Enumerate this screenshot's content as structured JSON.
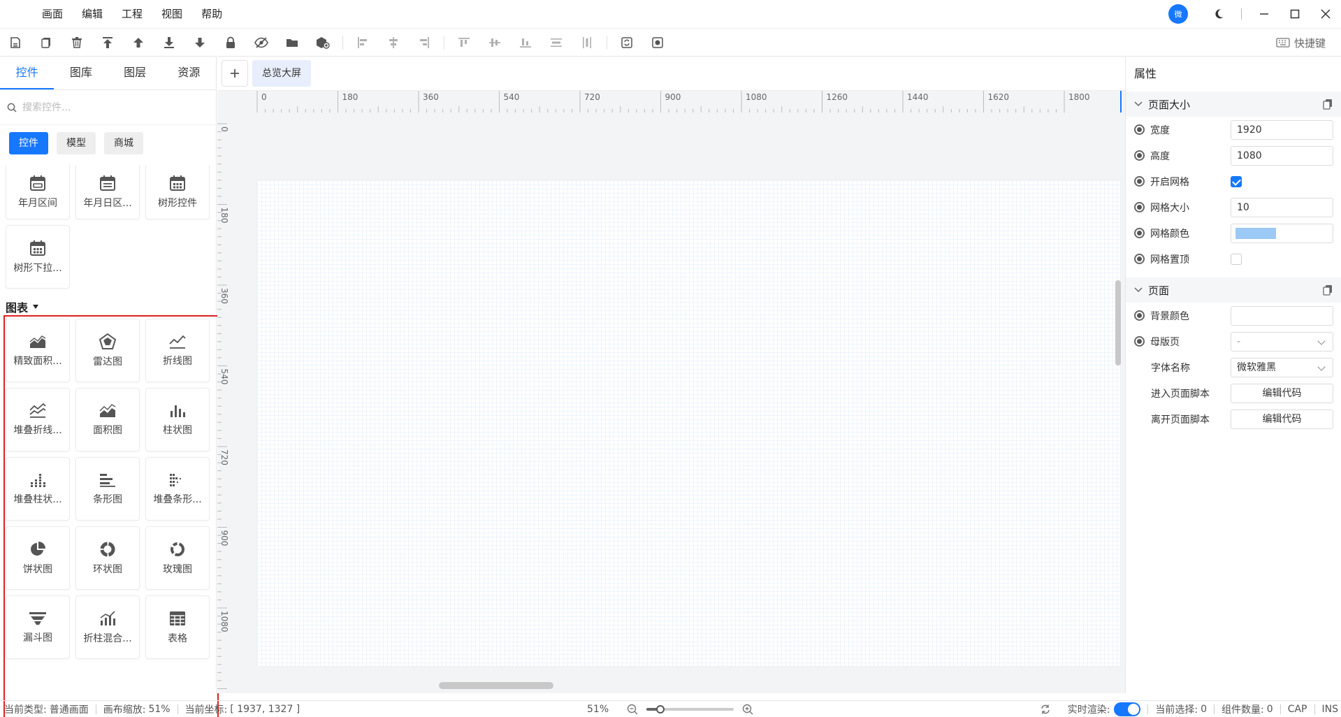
{
  "menubar": {
    "items": [
      "画面",
      "编辑",
      "工程",
      "视图",
      "帮助"
    ],
    "avatar_text": "微"
  },
  "toolbar": {
    "shortcut_label": "快捷键",
    "tools": [
      "save-icon",
      "copy-icon",
      "delete-icon",
      "move-top-icon",
      "move-up-icon",
      "move-bottom-icon",
      "move-down-icon",
      "lock-icon",
      "hide-icon",
      "open-folder-icon",
      "add-component-icon",
      "align-left-icon",
      "align-hcenter-icon",
      "align-right-icon",
      "align-top-icon",
      "align-vcenter-icon",
      "align-bottom-icon",
      "distribute-h-icon",
      "distribute-v-icon",
      "refresh-icon",
      "record-icon"
    ]
  },
  "left_panel": {
    "tabs": [
      "控件",
      "图库",
      "图层",
      "资源"
    ],
    "search_placeholder": "搜索控件...",
    "categories": [
      "控件",
      "模型",
      "商城"
    ],
    "widgets": [
      "年月区间",
      "年月日区...",
      "树形控件",
      "树形下拉..."
    ],
    "chart_section_title": "图表",
    "charts": [
      "精致面积...",
      "雷达图",
      "折线图",
      "堆叠折线...",
      "面积图",
      "柱状图",
      "堆叠柱状...",
      "条形图",
      "堆叠条形...",
      "饼状图",
      "环状图",
      "玫瑰图",
      "漏斗图",
      "折柱混合...",
      "表格"
    ],
    "accent_color": "#1677ff",
    "highlight_color": "#e02020"
  },
  "canvas": {
    "page_tab": "总览大屏",
    "h_ruler": [
      "0",
      "180",
      "360",
      "540",
      "720",
      "900",
      "1080",
      "1260",
      "1440",
      "1620",
      "1800"
    ],
    "v_ruler": [
      "0",
      "180",
      "360",
      "540",
      "720",
      "900",
      "1080"
    ]
  },
  "properties": {
    "title": "属性",
    "page_size": {
      "title": "页面大小",
      "width_label": "宽度",
      "width": "1920",
      "height_label": "高度",
      "height": "1080",
      "grid_enable_label": "开启网格",
      "grid_size_label": "网格大小",
      "grid_size": "10",
      "grid_color_label": "网格颜色",
      "grid_color": "#9cc9f5",
      "grid_top_label": "网格置顶"
    },
    "page": {
      "title": "页面",
      "bg_color_label": "背景颜色",
      "master_label": "母版页",
      "master_value": "-",
      "font_label": "字体名称",
      "font_value": "微软雅黑",
      "enter_script_label": "进入页面脚本",
      "enter_script_btn": "编辑代码",
      "leave_script_label": "离开页面脚本",
      "leave_script_btn": "编辑代码"
    }
  },
  "status": {
    "type_label": "当前类型:",
    "type_value": "普通画面",
    "zoom_label": "画布缩放:",
    "zoom_value": "51%",
    "coord_label": "当前坐标:",
    "coord_value": "[ 1937, 1327 ]",
    "zoom_center": "51%",
    "realtime_label": "实时渲染:",
    "selection_label": "当前选择:",
    "selection_value": "0",
    "count_label": "组件数量:",
    "count_value": "0",
    "cap": "CAP",
    "ins": "INS"
  }
}
